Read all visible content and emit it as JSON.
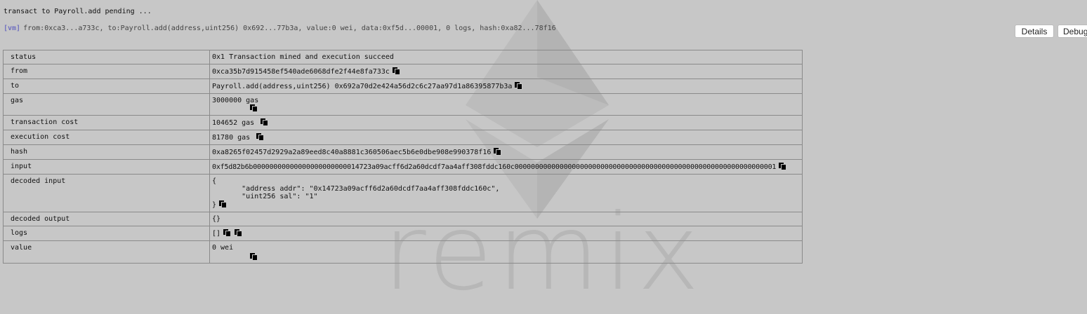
{
  "log": {
    "pending_text": "transact to Payroll.add pending ...",
    "tag": "[vm]",
    "summary": "from:0xca3...a733c, to:Payroll.add(address,uint256) 0x692...77b3a, value:0 wei, data:0xf5d...00001, 0 logs, hash:0xa82...78f16"
  },
  "buttons": {
    "details": "Details",
    "debug": "Debug"
  },
  "watermark": "remix",
  "rows": {
    "status": {
      "key": "status",
      "value": "0x1 Transaction mined and execution succeed"
    },
    "from": {
      "key": "from",
      "value": "0xca35b7d915458ef540ade6068dfe2f44e8fa733c"
    },
    "to": {
      "key": "to",
      "value": "Payroll.add(address,uint256) 0x692a70d2e424a56d2c6c27aa97d1a86395877b3a"
    },
    "gas": {
      "key": "gas",
      "value": "3000000 gas"
    },
    "transaction_cost": {
      "key": "transaction cost",
      "value": "104652 gas"
    },
    "execution_cost": {
      "key": "execution cost",
      "value": "81780 gas"
    },
    "hash": {
      "key": "hash",
      "value": "0xa8265f02457d2929a2a89eed8c40a8881c360506aec5b6e0dbe908e990378f16"
    },
    "input": {
      "key": "input",
      "value": "0xf5d82b6b00000000000000000000000014723a09acff6d2a60dcdf7aa4aff308fddc160c0000000000000000000000000000000000000000000000000000000000000001"
    },
    "decoded_input": {
      "key": "decoded input",
      "open": "{",
      "line1": "\t\"address addr\": \"0x14723a09acff6d2a60dcdf7aa4aff308fddc160c\",",
      "line2": "\t\"uint256 sal\": \"1\"",
      "close": "}"
    },
    "decoded_output": {
      "key": "decoded output",
      "value": "{}"
    },
    "logs": {
      "key": "logs",
      "value": "[]"
    },
    "value": {
      "key": "value",
      "value": "0 wei"
    }
  }
}
